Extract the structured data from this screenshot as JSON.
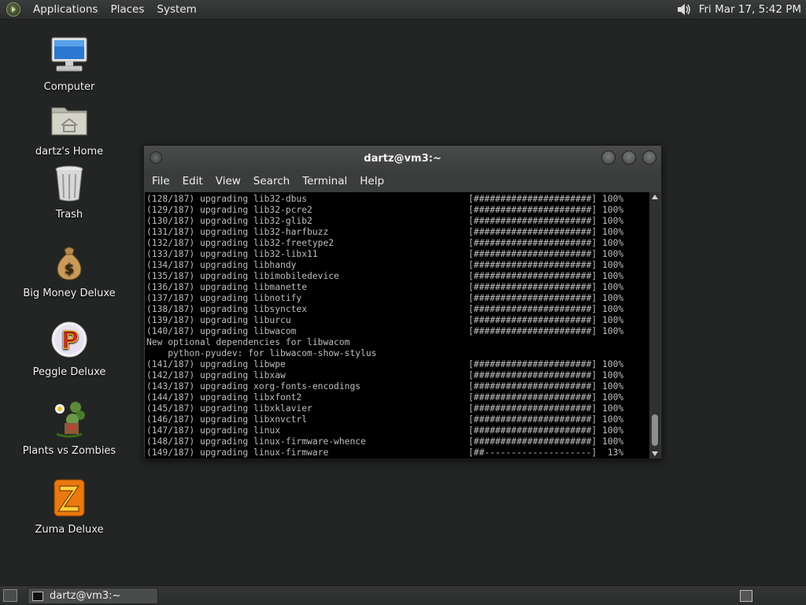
{
  "top_panel": {
    "menus": [
      "Applications",
      "Places",
      "System"
    ],
    "clock": "Fri Mar 17,  5:42 PM"
  },
  "desktop_icons": [
    {
      "label": "Computer",
      "icon": "computer-icon"
    },
    {
      "label": "dartz's Home",
      "icon": "home-folder-icon"
    },
    {
      "label": "Trash",
      "icon": "trash-icon"
    },
    {
      "label": "Big Money Deluxe",
      "icon": "money-bag-icon"
    },
    {
      "label": "Peggle Deluxe",
      "icon": "peggle-icon"
    },
    {
      "label": "Plants vs Zombies",
      "icon": "plants-vs-zombies-icon"
    },
    {
      "label": "Zuma Deluxe",
      "icon": "zuma-icon"
    }
  ],
  "terminal": {
    "title": "dartz@vm3:~",
    "menu": [
      "File",
      "Edit",
      "View",
      "Search",
      "Terminal",
      "Help"
    ],
    "lines": [
      {
        "left": "(128/187) upgrading lib32-dbus",
        "right": "[######################] 100%"
      },
      {
        "left": "(129/187) upgrading lib32-pcre2",
        "right": "[######################] 100%"
      },
      {
        "left": "(130/187) upgrading lib32-glib2",
        "right": "[######################] 100%"
      },
      {
        "left": "(131/187) upgrading lib32-harfbuzz",
        "right": "[######################] 100%"
      },
      {
        "left": "(132/187) upgrading lib32-freetype2",
        "right": "[######################] 100%"
      },
      {
        "left": "(133/187) upgrading lib32-libx11",
        "right": "[######################] 100%"
      },
      {
        "left": "(134/187) upgrading libhandy",
        "right": "[######################] 100%"
      },
      {
        "left": "(135/187) upgrading libimobiledevice",
        "right": "[######################] 100%"
      },
      {
        "left": "(136/187) upgrading libmanette",
        "right": "[######################] 100%"
      },
      {
        "left": "(137/187) upgrading libnotify",
        "right": "[######################] 100%"
      },
      {
        "left": "(138/187) upgrading libsynctex",
        "right": "[######################] 100%"
      },
      {
        "left": "(139/187) upgrading liburcu",
        "right": "[######################] 100%"
      },
      {
        "left": "(140/187) upgrading libwacom",
        "right": "[######################] 100%"
      },
      {
        "left": "New optional dependencies for libwacom",
        "right": ""
      },
      {
        "left": "    python-pyudev: for libwacom-show-stylus",
        "right": ""
      },
      {
        "left": "(141/187) upgrading libwpe",
        "right": "[######################] 100%"
      },
      {
        "left": "(142/187) upgrading libxaw",
        "right": "[######################] 100%"
      },
      {
        "left": "(143/187) upgrading xorg-fonts-encodings",
        "right": "[######################] 100%"
      },
      {
        "left": "(144/187) upgrading libxfont2",
        "right": "[######################] 100%"
      },
      {
        "left": "(145/187) upgrading libxklavier",
        "right": "[######################] 100%"
      },
      {
        "left": "(146/187) upgrading libxnvctrl",
        "right": "[######################] 100%"
      },
      {
        "left": "(147/187) upgrading linux",
        "right": "[######################] 100%"
      },
      {
        "left": "(148/187) upgrading linux-firmware-whence",
        "right": "[######################] 100%"
      },
      {
        "left": "(149/187) upgrading linux-firmware",
        "right": "[##--------------------]  13%"
      }
    ]
  },
  "taskbar": {
    "task_label": "dartz@vm3:~"
  }
}
